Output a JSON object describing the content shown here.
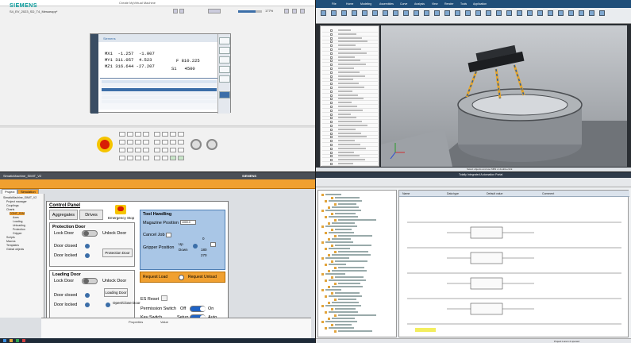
{
  "q1": {
    "logo": "SIEMENS",
    "window_title": "Create MyVirtual Machine",
    "project_tab": "S4_EV_2023_SD_T4_Messeapp*",
    "zoom": "177%",
    "hmi": {
      "header": "Siemens",
      "axes": [
        {
          "name": "MX1",
          "value": "-1.257",
          "dist": "-1.007"
        },
        {
          "name": "MY1",
          "value": "311.057",
          "dist": "4.523"
        },
        {
          "name": "MZ1",
          "value": "316.644",
          "dist": "-27.207"
        }
      ],
      "feed_label": "F",
      "feed_value": "810.225",
      "spindle_label": "S1",
      "spindle_value": "4500"
    }
  },
  "q2": {
    "menus": [
      "File",
      "Home",
      "Modeling",
      "Assemblies",
      "Curve",
      "Analysis",
      "View",
      "Render",
      "Tools",
      "Application"
    ],
    "status_text": "Select objects and use MB3 or double-click"
  },
  "q3": {
    "app_title": "SimaticMachine_SIMIT_V2",
    "brand": "SIEMENS",
    "tabs": [
      "Project",
      "Simulation"
    ],
    "nav_items": [
      "SimaticMachine_SIMIT_V2",
      "Project manager",
      "Couplings",
      "Charts",
      "CONT_S1M",
      "Axes",
      "Loading",
      "Unloading",
      "Protection",
      "Gripper",
      "Scripts",
      "Macros",
      "Templates",
      "Global objects"
    ],
    "control_panel": {
      "title": "Control Panel",
      "aggregates": "Aggregates",
      "drives": "Drives",
      "emergency": "Emergency Stop",
      "protection_door": {
        "title": "Protection Door",
        "lock": "Lock Door",
        "unlock": "Unlock Door",
        "closed": "Door closed",
        "locked": "Door locked",
        "button": "Protection Door"
      },
      "loading_door": {
        "title": "Loading Door",
        "lock": "Lock Door",
        "unlock": "Unlock Door",
        "closed": "Door closed",
        "locked": "Door locked",
        "button": "Loading Door",
        "open_close": "Open/Close Door"
      },
      "tool_handling": {
        "title": "Tool Handling",
        "magazine": "Magazine Position",
        "magazine_value": "1000.0",
        "cancel": "Cancel Job",
        "gripper": "Gripper Position",
        "up": "Up",
        "down": "Down",
        "v0": "0",
        "v180": "180",
        "v270": "270"
      },
      "request_load": "Request Load",
      "request_unload": "Request Unload",
      "es_reset": "ES Reset",
      "permission_switch": "Permission Switch",
      "off": "Off",
      "on": "On",
      "key_switch": "Key Switch",
      "setup": "Setup",
      "auto": "Auto"
    },
    "properties_title": "Properties",
    "properties_value_header": "Value"
  },
  "q4": {
    "window_title": "Totally Integrated Automation Portal",
    "columns": [
      "Name",
      "Data type",
      "Default value",
      "Comment"
    ],
    "status": "Project Lorem 2 opened"
  }
}
